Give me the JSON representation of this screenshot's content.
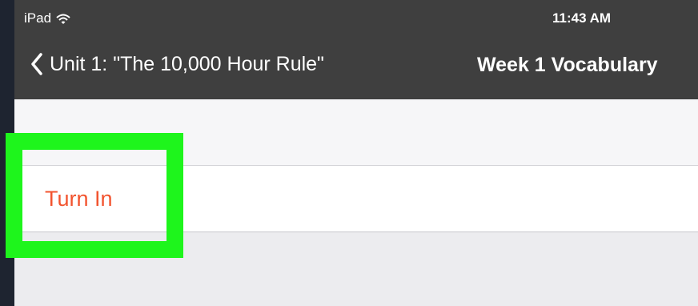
{
  "status_bar": {
    "device": "iPad",
    "wifi_icon": "wifi-icon",
    "time": "11:43 AM"
  },
  "nav_bar": {
    "back_icon": "chevron-left-icon",
    "back_label": "Unit 1: \"The 10,000 Hour Rule\"",
    "title": "Week 1 Vocabulary"
  },
  "actions": {
    "turn_in_label": "Turn In"
  },
  "colors": {
    "nav_background": "#3f3f3f",
    "action_text": "#f2542f",
    "highlight": "#1ef51c",
    "page_background": "#ececef"
  }
}
